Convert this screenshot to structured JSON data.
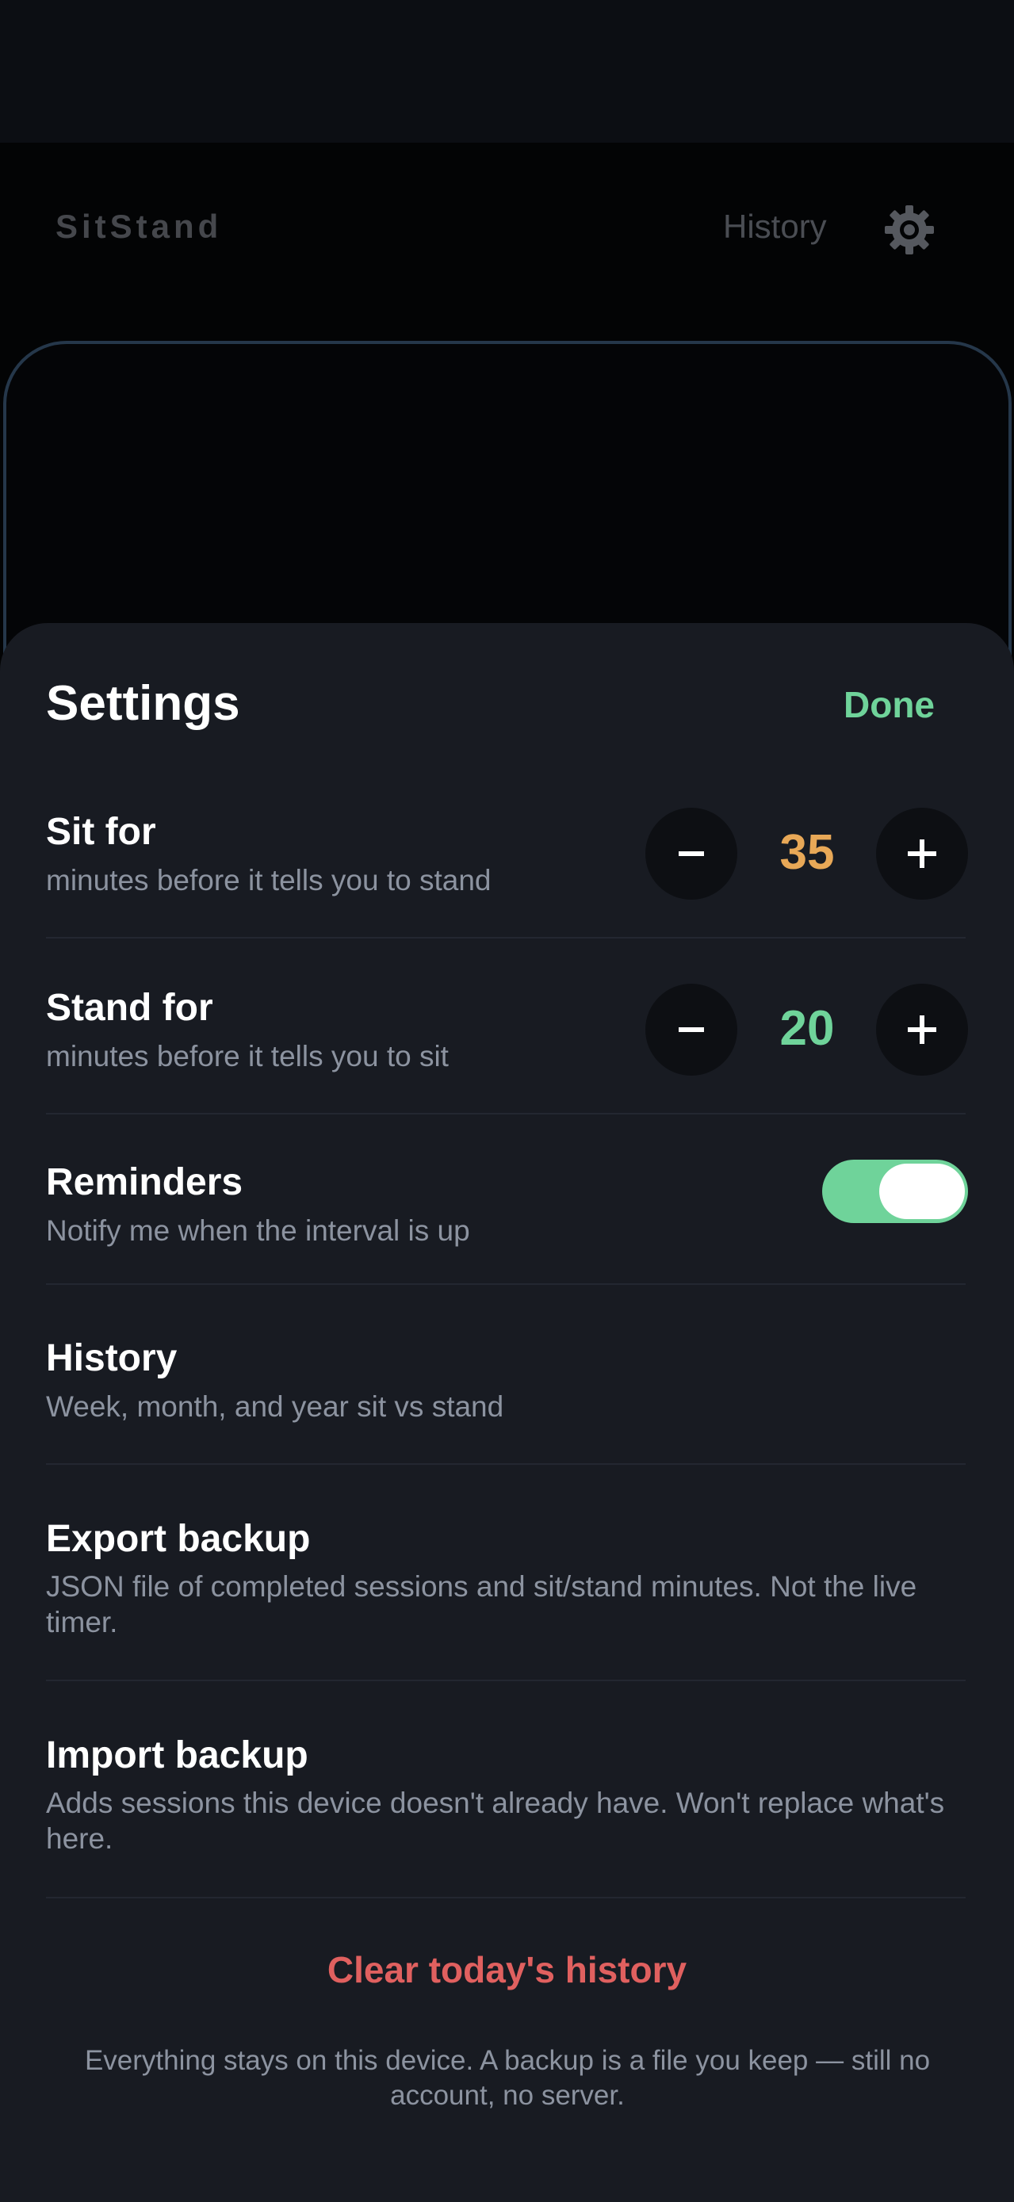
{
  "app": {
    "brand": "SitStand",
    "history_link": "History",
    "gear_icon": "gear-icon"
  },
  "settings": {
    "title": "Settings",
    "done_label": "Done",
    "sit": {
      "title": "Sit for",
      "subtitle": "minutes before it tells you to stand",
      "value": "35",
      "value_color": "#e8a857",
      "minus": "−",
      "plus": "+"
    },
    "stand": {
      "title": "Stand for",
      "subtitle": "minutes before it tells you to sit",
      "value": "20",
      "value_color": "#6fd39a",
      "minus": "−",
      "plus": "+"
    },
    "reminders": {
      "title": "Reminders",
      "subtitle": "Notify me when the interval is up",
      "enabled": true
    },
    "history": {
      "title": "History",
      "subtitle": "Week, month, and year sit vs stand"
    },
    "export": {
      "title": "Export backup",
      "subtitle": "JSON file of completed sessions and sit/stand minutes. Not the live timer."
    },
    "import": {
      "title": "Import backup",
      "subtitle": "Adds sessions this device doesn't already have. Won't replace what's here."
    },
    "clear_label": "Clear today's history",
    "footer_note": "Everything stays on this device. A backup is a file you keep — still no account, no server."
  },
  "colors": {
    "accent_green": "#6fd39a",
    "accent_orange": "#e8a857",
    "danger_red": "#e0605f",
    "sheet_bg": "#181b22"
  }
}
